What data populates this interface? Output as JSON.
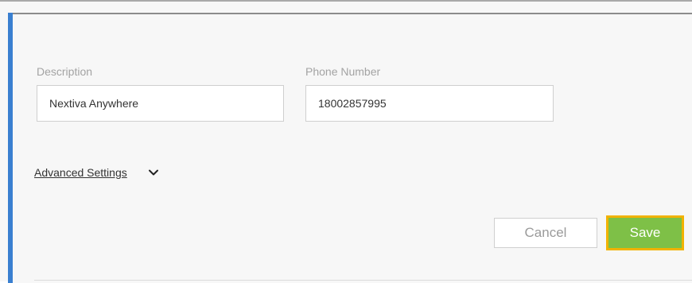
{
  "form": {
    "description": {
      "label": "Description",
      "value": "Nextiva Anywhere"
    },
    "phone_number": {
      "label": "Phone Number",
      "value": "18002857995"
    },
    "advanced_settings": {
      "label": "Advanced Settings",
      "icon": "chevron-down-icon"
    }
  },
  "actions": {
    "cancel_label": "Cancel",
    "save_label": "Save"
  },
  "colors": {
    "accent": "#3a7fd0",
    "save_button": "#7ec047",
    "save_highlight": "#f1b200"
  }
}
